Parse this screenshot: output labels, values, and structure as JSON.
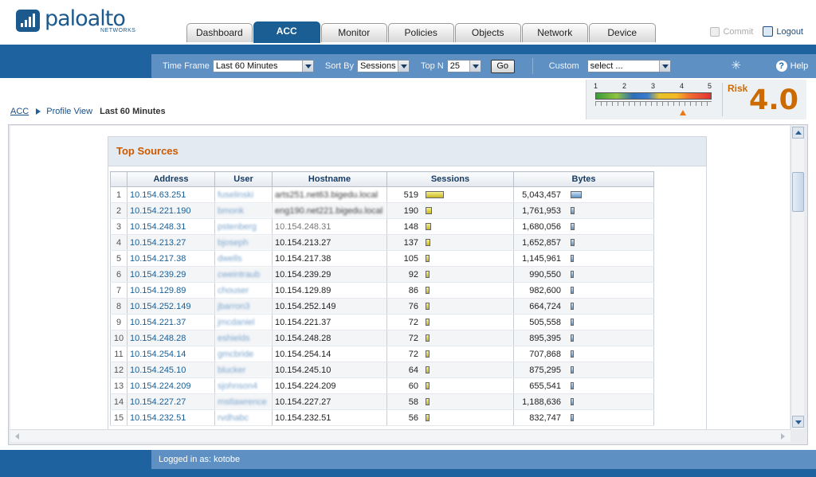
{
  "header": {
    "logo_text": "paloalto",
    "logo_sub": "NETWORKS",
    "tabs": [
      {
        "label": "Dashboard",
        "active": false
      },
      {
        "label": "ACC",
        "active": true
      },
      {
        "label": "Monitor",
        "active": false
      },
      {
        "label": "Policies",
        "active": false
      },
      {
        "label": "Objects",
        "active": false
      },
      {
        "label": "Network",
        "active": false
      },
      {
        "label": "Device",
        "active": false
      }
    ],
    "commit_label": "Commit",
    "logout_label": "Logout"
  },
  "toolbar": {
    "time_frame_label": "Time Frame",
    "time_frame_value": "Last 60 Minutes",
    "sort_by_label": "Sort By",
    "sort_by_value": "Sessions",
    "top_n_label": "Top N",
    "top_n_value": "25",
    "go_label": "Go",
    "custom_label": "Custom",
    "custom_value": "select ...",
    "help_label": "Help"
  },
  "breadcrumb": {
    "root": "ACC",
    "profile": "Profile View",
    "current": "Last 60 Minutes"
  },
  "risk": {
    "label": "Risk",
    "value": "4.0",
    "scale": [
      "1",
      "2",
      "3",
      "4",
      "5"
    ],
    "level": 4.0
  },
  "widget": {
    "title": "Top Sources",
    "columns": [
      "Address",
      "User",
      "Hostname",
      "Sessions",
      "Bytes"
    ],
    "rows": [
      {
        "n": "1",
        "address": "10.154.63.251",
        "user": "fuselinski",
        "hostname": "arts251.net63.bigedu.local",
        "host_blur": true,
        "sessions": "519",
        "bytes": "5,043,457",
        "sess_frac": 1.0,
        "bytes_frac": 1.0
      },
      {
        "n": "2",
        "address": "10.154.221.190",
        "user": "bmonk",
        "hostname": "eng190.net221.bigedu.local",
        "host_blur": true,
        "sessions": "190",
        "bytes": "1,761,953",
        "sess_frac": 0.366,
        "bytes_frac": 0.349
      },
      {
        "n": "3",
        "address": "10.154.248.31",
        "user": "pstenberg",
        "hostname": "10.154.248.31",
        "host_blur": false,
        "host_gray": true,
        "sessions": "148",
        "bytes": "1,680,056",
        "sess_frac": 0.285,
        "bytes_frac": 0.333
      },
      {
        "n": "4",
        "address": "10.154.213.27",
        "user": "bjoseph",
        "hostname": "10.154.213.27",
        "host_blur": false,
        "sessions": "137",
        "bytes": "1,652,857",
        "sess_frac": 0.264,
        "bytes_frac": 0.328
      },
      {
        "n": "5",
        "address": "10.154.217.38",
        "user": "dwells",
        "hostname": "10.154.217.38",
        "host_blur": false,
        "sessions": "105",
        "bytes": "1,145,961",
        "sess_frac": 0.202,
        "bytes_frac": 0.227
      },
      {
        "n": "6",
        "address": "10.154.239.29",
        "user": "cweintraub",
        "hostname": "10.154.239.29",
        "host_blur": false,
        "sessions": "92",
        "bytes": "990,550",
        "sess_frac": 0.177,
        "bytes_frac": 0.196
      },
      {
        "n": "7",
        "address": "10.154.129.89",
        "user": "chouser",
        "hostname": "10.154.129.89",
        "host_blur": false,
        "sessions": "86",
        "bytes": "982,600",
        "sess_frac": 0.166,
        "bytes_frac": 0.195
      },
      {
        "n": "8",
        "address": "10.154.252.149",
        "user": "jbarron3",
        "hostname": "10.154.252.149",
        "host_blur": false,
        "sessions": "76",
        "bytes": "664,724",
        "sess_frac": 0.146,
        "bytes_frac": 0.132
      },
      {
        "n": "9",
        "address": "10.154.221.37",
        "user": "jmcdaniel",
        "hostname": "10.154.221.37",
        "host_blur": false,
        "sessions": "72",
        "bytes": "505,558",
        "sess_frac": 0.139,
        "bytes_frac": 0.1
      },
      {
        "n": "10",
        "address": "10.154.248.28",
        "user": "eshields",
        "hostname": "10.154.248.28",
        "host_blur": false,
        "sessions": "72",
        "bytes": "895,395",
        "sess_frac": 0.139,
        "bytes_frac": 0.178
      },
      {
        "n": "11",
        "address": "10.154.254.14",
        "user": "gmcbride",
        "hostname": "10.154.254.14",
        "host_blur": false,
        "sessions": "72",
        "bytes": "707,868",
        "sess_frac": 0.139,
        "bytes_frac": 0.14
      },
      {
        "n": "12",
        "address": "10.154.245.10",
        "user": "blucker",
        "hostname": "10.154.245.10",
        "host_blur": false,
        "sessions": "64",
        "bytes": "875,295",
        "sess_frac": 0.123,
        "bytes_frac": 0.174
      },
      {
        "n": "13",
        "address": "10.154.224.209",
        "user": "sjohnson4",
        "hostname": "10.154.224.209",
        "host_blur": false,
        "sessions": "60",
        "bytes": "655,541",
        "sess_frac": 0.116,
        "bytes_frac": 0.13
      },
      {
        "n": "14",
        "address": "10.154.227.27",
        "user": "mstlawrence",
        "hostname": "10.154.227.27",
        "host_blur": false,
        "sessions": "58",
        "bytes": "1,188,636",
        "sess_frac": 0.112,
        "bytes_frac": 0.236
      },
      {
        "n": "15",
        "address": "10.154.232.51",
        "user": "rvdhabc",
        "hostname": "10.154.232.51",
        "host_blur": false,
        "sessions": "56",
        "bytes": "832,747",
        "sess_frac": 0.108,
        "bytes_frac": 0.165
      }
    ]
  },
  "footer": {
    "logged_in": "Logged in as: kotobe"
  }
}
